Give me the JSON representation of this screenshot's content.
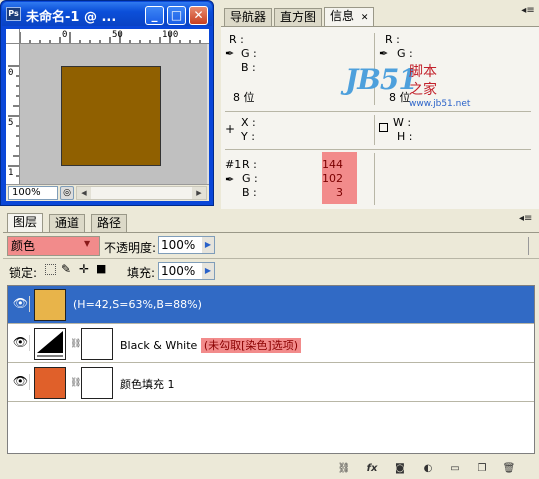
{
  "document": {
    "title": "未命名-1 @ ...",
    "app_icon_text": "Ps",
    "zoom": "100%",
    "ruler_top": [
      "0",
      "50",
      "100"
    ],
    "ruler_left": [
      "0",
      "5",
      "1"
    ],
    "fill_color": "#906000",
    "canvas_bg": "#c0c0c0"
  },
  "info_panel": {
    "tabs": [
      "导航器",
      "直方图",
      "信息"
    ],
    "active_tab": "信息",
    "rgb_labels": [
      "R :",
      "G :",
      "B :"
    ],
    "bit_depth_left": "8 位",
    "bit_depth_right": "8 位",
    "xy_labels": [
      "X :",
      "Y :"
    ],
    "wh_labels": [
      "W :",
      "H :"
    ],
    "sample_label": "#1",
    "sample_rgb_labels": [
      "R :",
      "G :",
      "B :"
    ],
    "sample_values": [
      "144",
      "102",
      "3"
    ]
  },
  "watermark": {
    "logo": "JB51",
    "name_line1": "脚本",
    "name_line2": "之家",
    "url": "www.jb51.net"
  },
  "layers_panel": {
    "tabs": [
      "图层",
      "通道",
      "路径"
    ],
    "active_tab": "图层",
    "blend_mode": "颜色",
    "opacity_label": "不透明度:",
    "opacity_value": "100%",
    "lock_label": "锁定:",
    "fill_label": "填充:",
    "fill_value": "100%",
    "layers": [
      {
        "name": "(H=42,S=63%,B=88%)",
        "thumb_color": "#e8b44a",
        "selected": true
      },
      {
        "name": "Black & White",
        "note": "(未勾取[染色]选项)",
        "selected": false
      },
      {
        "name": "颜色填充 1",
        "thumb_color": "#e0602a",
        "selected": false
      }
    ]
  },
  "colors": {
    "highlight": "#f28b8b",
    "selection": "#316ac5",
    "titlebar": "#0a47d8"
  }
}
